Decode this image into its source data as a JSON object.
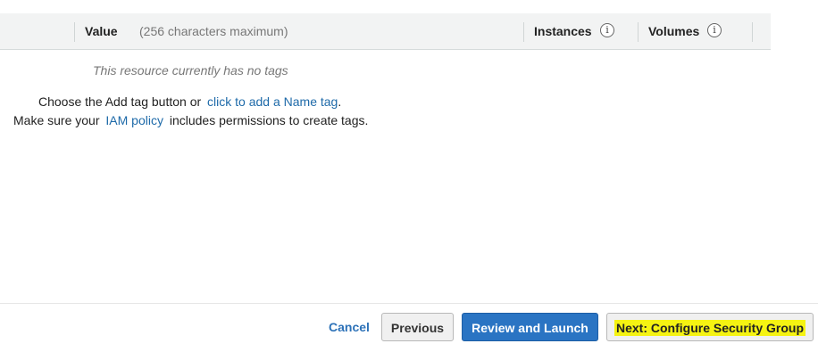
{
  "table": {
    "value_label": "Value",
    "value_hint": "(256 characters maximum)",
    "instances_label": "Instances",
    "volumes_label": "Volumes",
    "info_glyph": "i"
  },
  "empty_state": {
    "no_tags": "This resource currently has no tags",
    "line1_prefix": "Choose the Add tag button or",
    "line1_link": "click to add a Name tag",
    "line1_suffix": ".",
    "line2_prefix": "Make sure your",
    "line2_link": "IAM policy",
    "line2_suffix": "includes permissions to create tags."
  },
  "footer": {
    "cancel": "Cancel",
    "previous": "Previous",
    "review": "Review and Launch",
    "next": "Next: Configure Security Group"
  },
  "colors": {
    "header_bg": "#f2f3f3",
    "link": "#1e6aa9",
    "primary": "#2a74c3",
    "highlight": "#f5f312"
  }
}
